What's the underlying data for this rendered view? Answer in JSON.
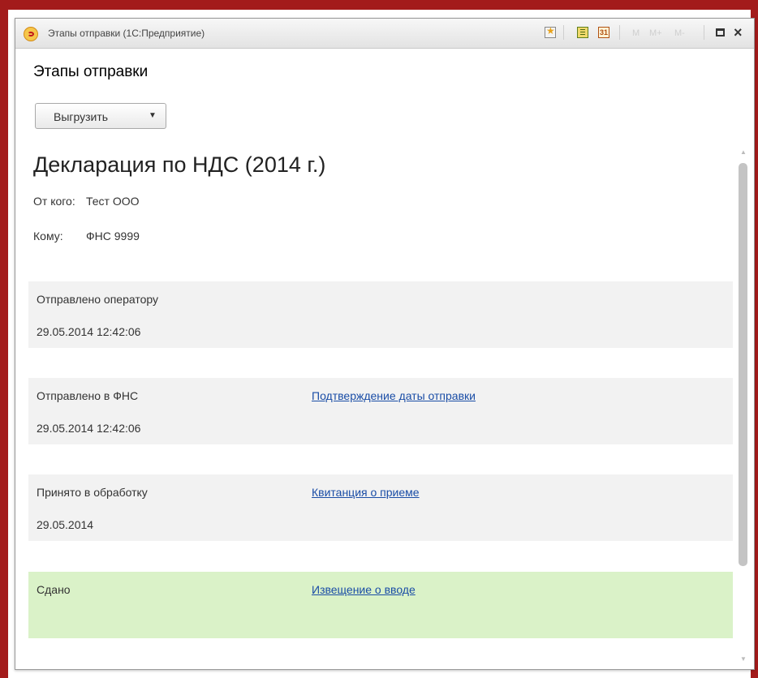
{
  "window": {
    "title": "Этапы отправки  (1С:Предприятие)",
    "memory_buttons": [
      "M",
      "M+",
      "M-"
    ]
  },
  "form": {
    "title": "Этапы отправки",
    "unload_button": "Выгрузить",
    "dropdown_arrow": "▼"
  },
  "document": {
    "title": "Декларация по НДС (2014 г.)",
    "from_label": "От кого:",
    "from_value": "Тест ООО",
    "to_label": "Кому:",
    "to_value": "ФНС 9999"
  },
  "stages": [
    {
      "name": "Отправлено оператору",
      "date": "29.05.2014 12:42:06",
      "link": ""
    },
    {
      "name": "Отправлено в ФНС",
      "date": "29.05.2014 12:42:06",
      "link": "Подтверждение даты отправки"
    },
    {
      "name": "Принято в обработку",
      "date": "29.05.2014",
      "link": "Квитанция о приеме"
    },
    {
      "name": "Сдано",
      "date": "",
      "link": "Извещение о вводе"
    }
  ],
  "colors": {
    "frame": "#a31b1b",
    "stage_background": "#f2f2f2",
    "done_background": "#daf2c8",
    "link": "#1a4da6"
  },
  "icons": [
    "app-logo-icon",
    "favorites-star-icon",
    "calculator-icon",
    "calendar-icon",
    "maximize-icon",
    "close-icon",
    "dropdown-arrow-icon"
  ]
}
